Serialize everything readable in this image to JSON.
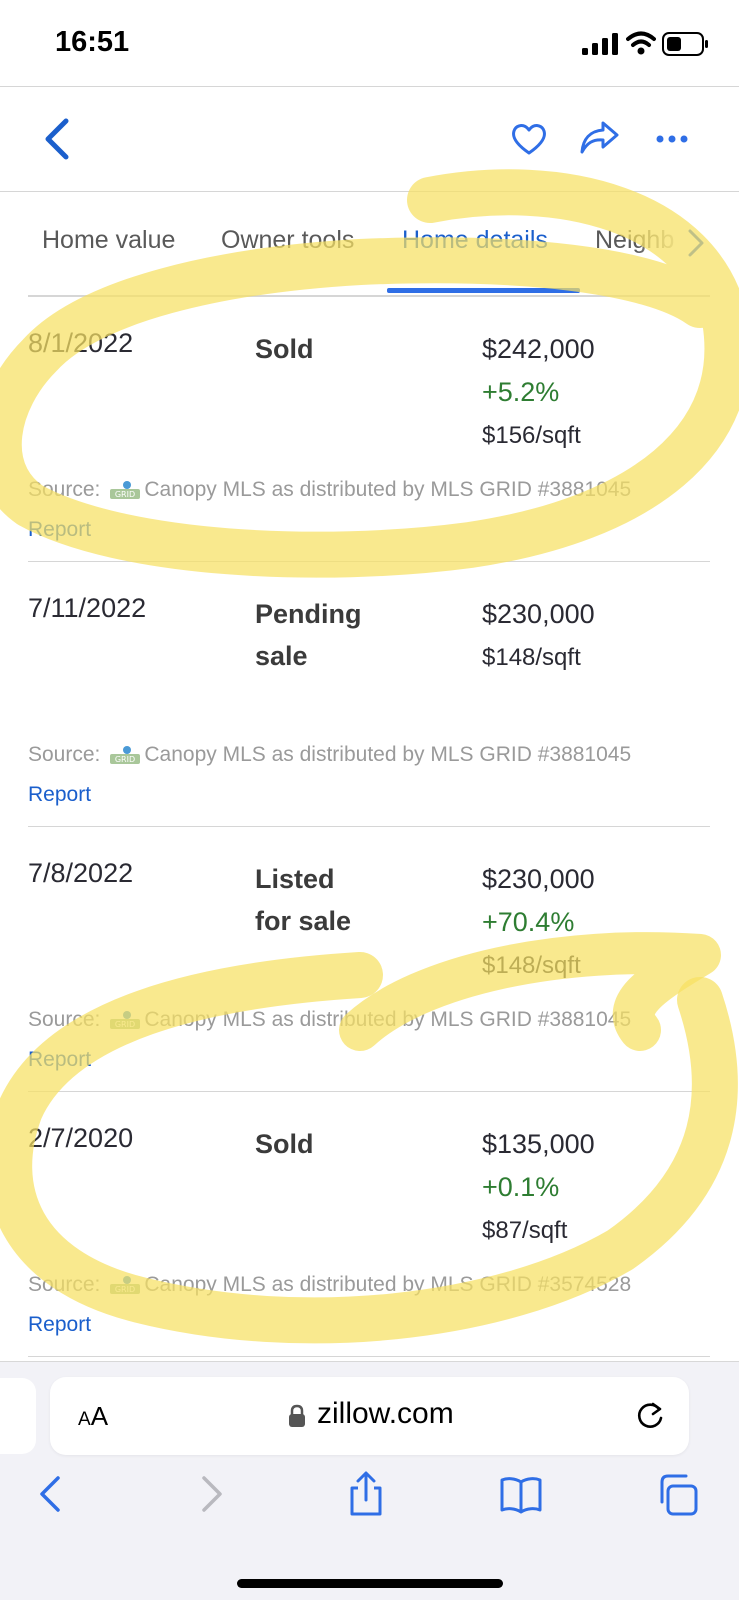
{
  "status_bar": {
    "time": "16:51"
  },
  "tabs": [
    {
      "label": "Home value",
      "active": false
    },
    {
      "label": "Owner tools",
      "active": false
    },
    {
      "label": "Home details",
      "active": true
    },
    {
      "label": "Neighb",
      "active": false
    }
  ],
  "history": [
    {
      "date": "8/1/2022",
      "event": [
        "Sold"
      ],
      "price": "$242,000",
      "change": "+5.2%",
      "sqft": "$156/sqft",
      "source_label": "Source:",
      "source": "Canopy MLS as distributed by MLS GRID #3881045",
      "report": "Report"
    },
    {
      "date": "7/11/2022",
      "event": [
        "Pending",
        "sale"
      ],
      "price": "$230,000",
      "change": "",
      "sqft": "$148/sqft",
      "source_label": "Source:",
      "source": "Canopy MLS as distributed by MLS GRID #3881045",
      "report": "Report"
    },
    {
      "date": "7/8/2022",
      "event": [
        "Listed",
        "for sale"
      ],
      "price": "$230,000",
      "change": "+70.4%",
      "sqft": "$148/sqft",
      "source_label": "Source:",
      "source": "Canopy MLS as distributed by MLS GRID #3881045",
      "report": "Report"
    },
    {
      "date": "2/7/2020",
      "event": [
        "Sold"
      ],
      "price": "$135,000",
      "change": "+0.1%",
      "sqft": "$87/sqft",
      "source_label": "Source:",
      "source": "Canopy MLS as distributed by MLS GRID #3574528",
      "report": "Report"
    }
  ],
  "browser": {
    "aa_label": "AA",
    "url": "zillow.com"
  },
  "colors": {
    "accent": "#2f6ee6",
    "positive": "#2e7d32",
    "highlighter": "#f7e163"
  },
  "icons": [
    "back-icon",
    "heart-icon",
    "share-icon",
    "more-icon",
    "chevron-right-icon",
    "lock-icon",
    "reload-icon",
    "browser-back-icon",
    "browser-forward-icon",
    "share-sheet-icon",
    "bookmarks-icon",
    "tabs-icon"
  ]
}
